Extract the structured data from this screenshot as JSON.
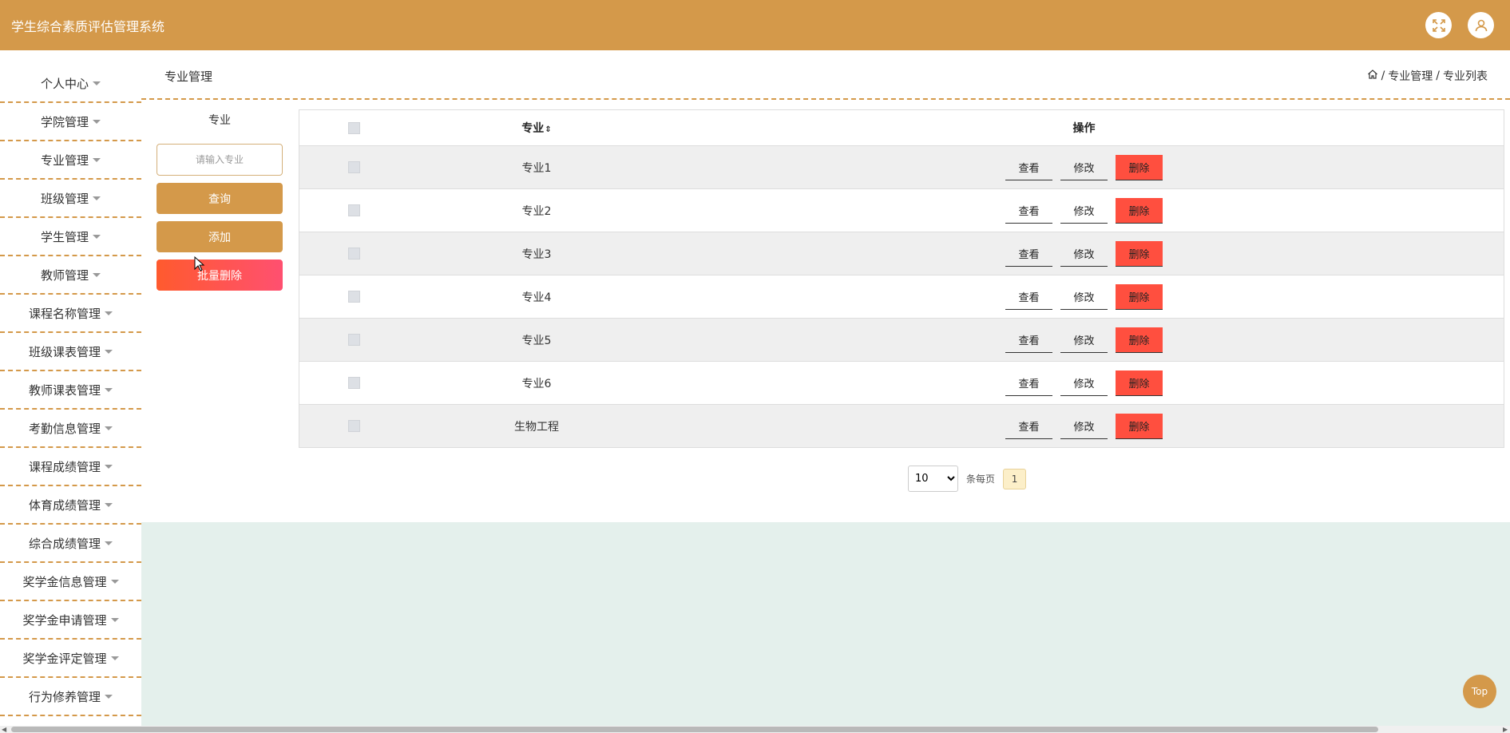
{
  "app": {
    "title": "学生综合素质评估管理系统"
  },
  "header_icons": [
    "fullscreen-icon",
    "user-icon"
  ],
  "sidebar": {
    "items": [
      {
        "label": "个人中心"
      },
      {
        "label": "学院管理"
      },
      {
        "label": "专业管理"
      },
      {
        "label": "班级管理"
      },
      {
        "label": "学生管理"
      },
      {
        "label": "教师管理"
      },
      {
        "label": "课程名称管理"
      },
      {
        "label": "班级课表管理"
      },
      {
        "label": "教师课表管理"
      },
      {
        "label": "考勤信息管理"
      },
      {
        "label": "课程成绩管理"
      },
      {
        "label": "体育成绩管理"
      },
      {
        "label": "综合成绩管理"
      },
      {
        "label": "奖学金信息管理"
      },
      {
        "label": "奖学金申请管理"
      },
      {
        "label": "奖学金评定管理"
      },
      {
        "label": "行为修养管理"
      }
    ]
  },
  "page": {
    "title": "专业管理",
    "breadcrumb": [
      "专业管理",
      "专业列表"
    ]
  },
  "filter": {
    "label": "专业",
    "placeholder": "请输入专业",
    "search_label": "查询",
    "add_label": "添加",
    "batch_delete_label": "批量删除"
  },
  "table": {
    "columns": {
      "name": "专业",
      "sort_icon": "⇕",
      "actions": "操作"
    },
    "action_labels": {
      "view": "查看",
      "edit": "修改",
      "delete": "删除"
    },
    "rows": [
      {
        "name": "专业1"
      },
      {
        "name": "专业2"
      },
      {
        "name": "专业3"
      },
      {
        "name": "专业4"
      },
      {
        "name": "专业5"
      },
      {
        "name": "专业6"
      },
      {
        "name": "生物工程"
      }
    ]
  },
  "pagination": {
    "page_size": "10",
    "page_size_suffix": "条每页",
    "current_page": "1"
  },
  "top_button": "Top",
  "colors": {
    "primary": "#d4994a",
    "danger": "#ff4f3f",
    "panel": "#e4f0ec"
  }
}
